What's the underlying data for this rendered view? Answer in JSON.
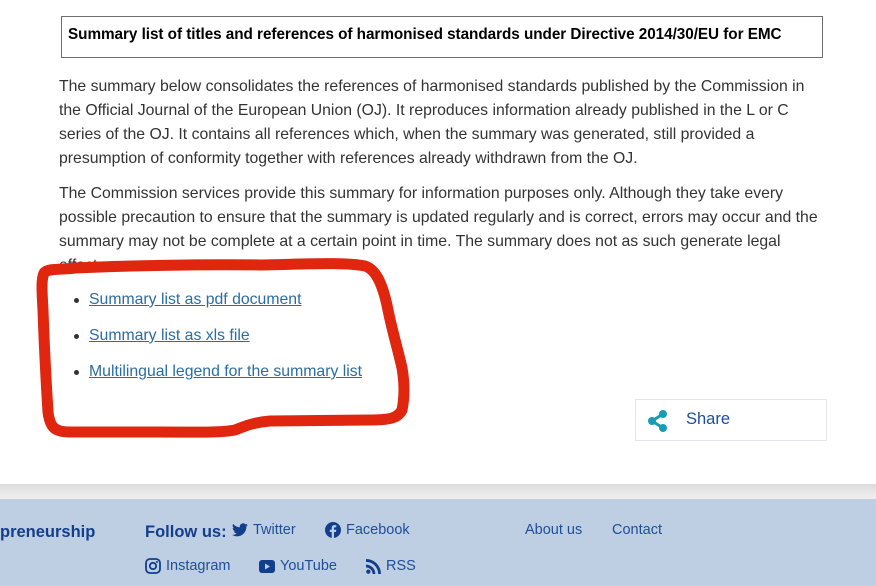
{
  "title": "Summary list of titles and references of harmonised standards under Directive 2014/30/EU for EMC",
  "paragraphs": [
    "The summary below consolidates the references of harmonised standards published by the Commission in the Official Journal of the European Union (OJ). It reproduces information already published in the L or C series of the OJ. It contains all references which, when the summary was generated, still provided a presumption of conformity together with references already withdrawn from the OJ.",
    "The Commission services provide this summary for information purposes only. Although they take every possible precaution to ensure that the summary is updated regularly and is correct, errors may occur and the summary may not be complete at a certain point in time. The summary does not as such generate legal effects."
  ],
  "links": [
    {
      "label": "Summary list as pdf document"
    },
    {
      "label": "Summary list as xls file"
    },
    {
      "label": "Multilingual legend for the summary list"
    }
  ],
  "share": {
    "label": "Share",
    "icon": "share-icon"
  },
  "annotation": {
    "color": "#e0260f",
    "shape": "hand-drawn outline around download links"
  },
  "footer": {
    "site_name_fragment": "preneurship",
    "follow_label": "Follow us:",
    "social": [
      {
        "label": "Twitter",
        "icon": "twitter-icon"
      },
      {
        "label": "Facebook",
        "icon": "facebook-icon"
      },
      {
        "label": "Instagram",
        "icon": "instagram-icon"
      },
      {
        "label": "YouTube",
        "icon": "youtube-icon"
      },
      {
        "label": "RSS",
        "icon": "rss-icon"
      }
    ],
    "nav": [
      {
        "label": "About us"
      },
      {
        "label": "Contact"
      }
    ]
  },
  "colors": {
    "link": "#2b6ca3",
    "footer_bg": "#bfcfe3",
    "footer_text": "#1e4e9a",
    "share_icon": "#1a9bb5",
    "annotation": "#e0260f"
  }
}
